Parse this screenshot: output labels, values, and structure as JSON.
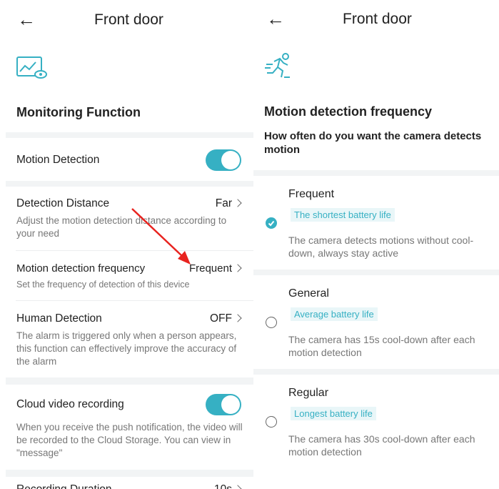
{
  "left": {
    "header": {
      "back_icon": "arrow-left-icon",
      "title": "Front door"
    },
    "feature_icon": "monitor-eye-icon",
    "section_title": "Monitoring Function",
    "motion_detection": {
      "label": "Motion Detection",
      "enabled": true
    },
    "detection_distance": {
      "label": "Detection Distance",
      "value": "Far",
      "desc": "Adjust the motion detection distance according to your need"
    },
    "motion_frequency": {
      "label": "Motion detection frequency",
      "value": "Frequent",
      "desc": "Set the frequency of detection of this device"
    },
    "human_detection": {
      "label": "Human Detection",
      "value": "OFF",
      "desc": "The alarm is triggered only when a person appears, this function can effectively improve the accuracy of the alarm"
    },
    "cloud_recording": {
      "label": "Cloud video recording",
      "enabled": true,
      "desc": "When you receive the push notification, the video will be recorded to the Cloud Storage. You can view in \"message\""
    },
    "recording_duration": {
      "label": "Recording Duration",
      "value": "10s"
    },
    "accent_color": "#36b0c3",
    "arrow_color": "#e8231f"
  },
  "right": {
    "header": {
      "back_icon": "arrow-left-icon",
      "title": "Front door"
    },
    "feature_icon": "running-person-icon",
    "section_title": "Motion detection frequency",
    "question": "How often do you want the camera detects motion",
    "options": [
      {
        "title": "Frequent",
        "badge": "The shortest battery life",
        "desc": "The camera detects motions without cool-down, always stay active",
        "selected": true
      },
      {
        "title": "General",
        "badge": "Average battery life",
        "desc": "The camera has 15s cool-down after each motion detection",
        "selected": false
      },
      {
        "title": "Regular",
        "badge": "Longest battery life",
        "desc": "The camera has 30s cool-down after each motion detection",
        "selected": false
      }
    ]
  }
}
